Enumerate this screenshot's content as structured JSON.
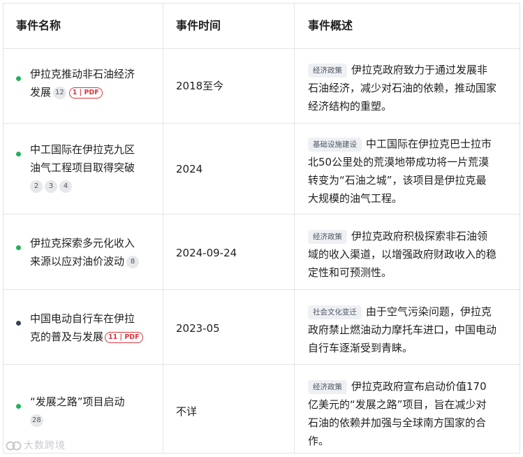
{
  "colors": {
    "green_dot": "#22b25a",
    "navy_dot": "#3b4257",
    "pdf_red": "#d9363e",
    "tag_bg": "#eef0f3"
  },
  "headers": {
    "name": "事件名称",
    "time": "事件时间",
    "desc": "事件概述"
  },
  "rows": [
    {
      "name_lines": [
        "伊拉克推动非石油经济",
        "发展"
      ],
      "dot": "green",
      "cites": [
        "12"
      ],
      "pdf": "1 | PDF",
      "time": "2018至今",
      "tag": "经济政策",
      "desc_lines": [
        "伊拉克政府致力于通过发展非",
        "石油经济，减少对石油的依赖，推动国家",
        "经济结构的重塑。"
      ]
    },
    {
      "name_lines": [
        "中工国际在伊拉克九区",
        "油气工程项目取得突破"
      ],
      "dot": "green",
      "cites": [
        "2",
        "3",
        "4"
      ],
      "time": "2024",
      "tag": "基础设施建设",
      "desc_lines": [
        "中工国际在伊拉克巴士拉市",
        "北50公里处的荒漠地带成功将一片荒漠",
        "转变为“石油之城”，该项目是伊拉克最",
        "大规模的油气工程。"
      ]
    },
    {
      "name_lines": [
        "伊拉克探索多元化收入",
        "来源以应对油价波动"
      ],
      "dot": "green",
      "cites": [
        "8"
      ],
      "time": "2024-09-24",
      "tag": "经济政策",
      "desc_lines": [
        "伊拉克政府积极探索非石油领",
        "域的收入渠道，以增强政府财政收入的稳",
        "定性和可预测性。"
      ]
    },
    {
      "name_lines": [
        "中国电动自行车在伊拉",
        "克的普及与发展"
      ],
      "dot": "navy",
      "cites": [],
      "pdf": "11 | PDF",
      "time": "2023-05",
      "tag": "社会文化变迁",
      "desc_lines": [
        "由于空气污染问题，伊拉克",
        "政府禁止燃油动力摩托车进口，中国电动",
        "自行车逐渐受到青睐。"
      ]
    },
    {
      "name_lines": [
        "“发展之路”项目启动"
      ],
      "dot": "green",
      "cites": [
        "28"
      ],
      "time": "不详",
      "tag": "经济政策",
      "desc_lines": [
        "伊拉克政府宣布启动价值170",
        "亿美元的“发展之路”项目，旨在减少对",
        "石油的依赖并加强与全球南方国家的合",
        "作。"
      ]
    }
  ],
  "watermark": "大数跨境",
  "watermark_icon": "logo-icon"
}
